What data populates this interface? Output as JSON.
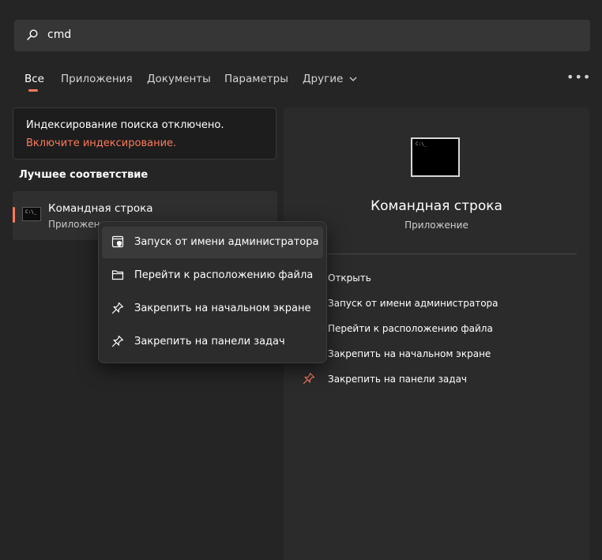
{
  "search": {
    "query": "cmd"
  },
  "tabs": [
    {
      "label": "Все"
    },
    {
      "label": "Приложения"
    },
    {
      "label": "Документы"
    },
    {
      "label": "Параметры"
    },
    {
      "label": "Другие"
    }
  ],
  "more_label": "•••",
  "notice": {
    "text": "Индексирование поиска отключено.",
    "link": "Включите индексирование."
  },
  "best_match": {
    "title": "Лучшее соответствие",
    "name": "Командная строка",
    "type": "Приложение"
  },
  "details": {
    "title": "Командная строка",
    "subtitle": "Приложение",
    "actions": [
      {
        "label": "Открыть"
      },
      {
        "label": "Запуск от имени администратора"
      },
      {
        "label": "Перейти к расположению файла"
      },
      {
        "label": "Закрепить на начальном экране"
      },
      {
        "label": "Закрепить на панели задач"
      }
    ]
  },
  "context_menu": {
    "items": [
      {
        "label": "Запуск от имени администратора",
        "icon": "shield-window-icon"
      },
      {
        "label": "Перейти к расположению файла",
        "icon": "folder-icon"
      },
      {
        "label": "Закрепить на начальном экране",
        "icon": "pin-icon"
      },
      {
        "label": "Закрепить на панели задач",
        "icon": "pin-icon"
      }
    ]
  },
  "colors": {
    "accent": "#ff7a5c",
    "background": "#252525"
  }
}
